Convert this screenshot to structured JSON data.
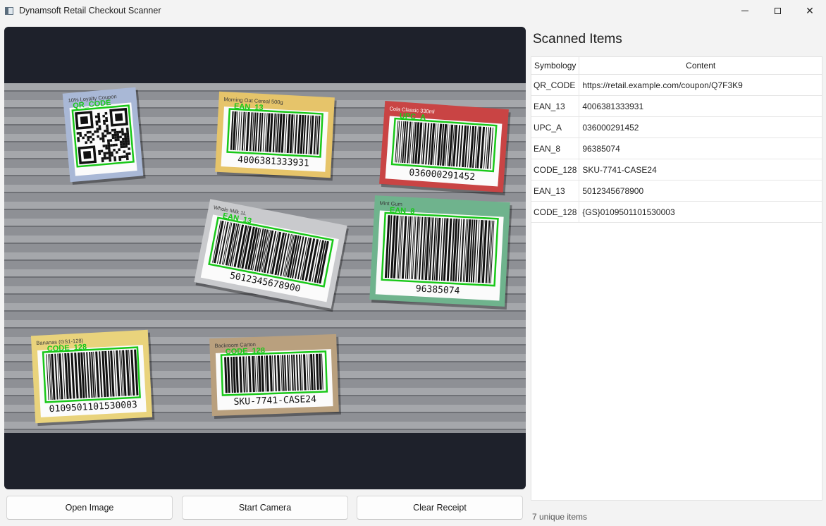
{
  "window": {
    "title": "Dynamsoft Retail Checkout Scanner"
  },
  "theme": {
    "viewer_bg": "#1e212b",
    "detect_green": "#19c819",
    "shelf_gray": "#8e9095"
  },
  "viewer": {
    "labels": [
      {
        "id": "coupon",
        "caption": "10% Loyalty Coupon",
        "symbology": "QR_CODE",
        "digits": "",
        "color": "#a9b8d6"
      },
      {
        "id": "cereal",
        "caption": "Morning Oat Cereal 500g",
        "symbology": "EAN_13",
        "digits": "4006381333931",
        "color": "#e6c46a"
      },
      {
        "id": "cola",
        "caption": "Cola Classic 330ml",
        "symbology": "UPC_A",
        "digits": "036000291452",
        "color": "#c94444"
      },
      {
        "id": "milk",
        "caption": "Whole Milk 1L",
        "symbology": "EAN_13",
        "digits": "5012345678900",
        "color": "#c9cacd"
      },
      {
        "id": "gum",
        "caption": "Mint Gum",
        "symbology": "EAN_8",
        "digits": "96385074",
        "color": "#6fb38d"
      },
      {
        "id": "bananas",
        "caption": "Bananas (GS1-128)",
        "symbology": "CODE_128",
        "digits": "0109501101530003",
        "color": "#e9d37c"
      },
      {
        "id": "carton",
        "caption": "Backroom Carton",
        "symbology": "CODE_128",
        "digits": "SKU-7741-CASE24",
        "color": "#b9a07e"
      }
    ]
  },
  "buttons": {
    "open": "Open Image",
    "camera": "Start Camera",
    "clear": "Clear Receipt"
  },
  "panel": {
    "title": "Scanned Items",
    "columns": [
      "Symbology",
      "Content"
    ],
    "rows": [
      {
        "symbology": "QR_CODE",
        "content": "https://retail.example.com/coupon/Q7F3K9"
      },
      {
        "symbology": "EAN_13",
        "content": "4006381333931"
      },
      {
        "symbology": "UPC_A",
        "content": "036000291452"
      },
      {
        "symbology": "EAN_8",
        "content": "96385074"
      },
      {
        "symbology": "CODE_128",
        "content": "SKU-7741-CASE24"
      },
      {
        "symbology": "EAN_13",
        "content": "5012345678900"
      },
      {
        "symbology": "CODE_128",
        "content": "{GS}0109501101530003"
      }
    ]
  },
  "status": "7 unique items"
}
